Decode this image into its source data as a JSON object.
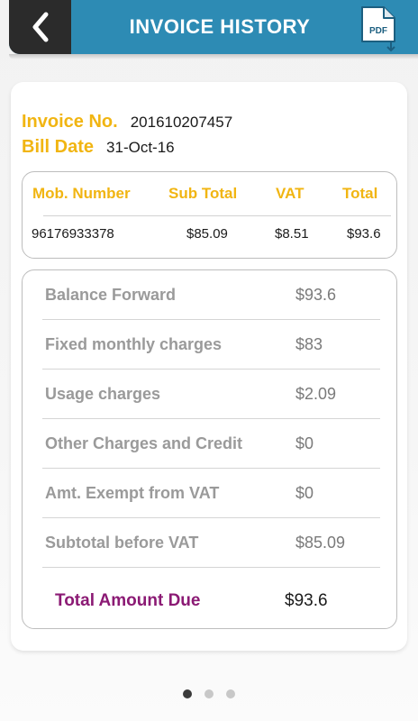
{
  "header": {
    "title": "INVOICE HISTORY",
    "back_icon": "chevron-left-icon",
    "pdf_icon": "pdf-download-icon",
    "pdf_label": "PDF",
    "bar_color": "#2d8bb4",
    "back_color": "#2b2b2b"
  },
  "invoice": {
    "number_label": "Invoice No.",
    "number_value": "201610207457",
    "date_label": "Bill Date",
    "date_value": "31-Oct-16"
  },
  "summary": {
    "headers": [
      "Mob. Number",
      "Sub Total",
      "VAT",
      "Total"
    ],
    "row": [
      "96176933378",
      "$85.09",
      "$8.51",
      "$93.6"
    ]
  },
  "charges": [
    {
      "label": "Balance Forward",
      "value": "$93.6"
    },
    {
      "label": "Fixed monthly charges",
      "value": "$83"
    },
    {
      "label": "Usage charges",
      "value": "$2.09"
    },
    {
      "label": "Other Charges and Credit",
      "value": "$0"
    },
    {
      "label": "Amt. Exempt from VAT",
      "value": "$0"
    },
    {
      "label": "Subtotal before VAT",
      "value": "$85.09"
    }
  ],
  "total": {
    "label": "Total Amount Due",
    "value": "$93.6"
  },
  "pagination": {
    "count": 3,
    "active_index": 0
  },
  "colors": {
    "accent_yellow": "#f1b512",
    "total_purple": "#8b1a74"
  }
}
